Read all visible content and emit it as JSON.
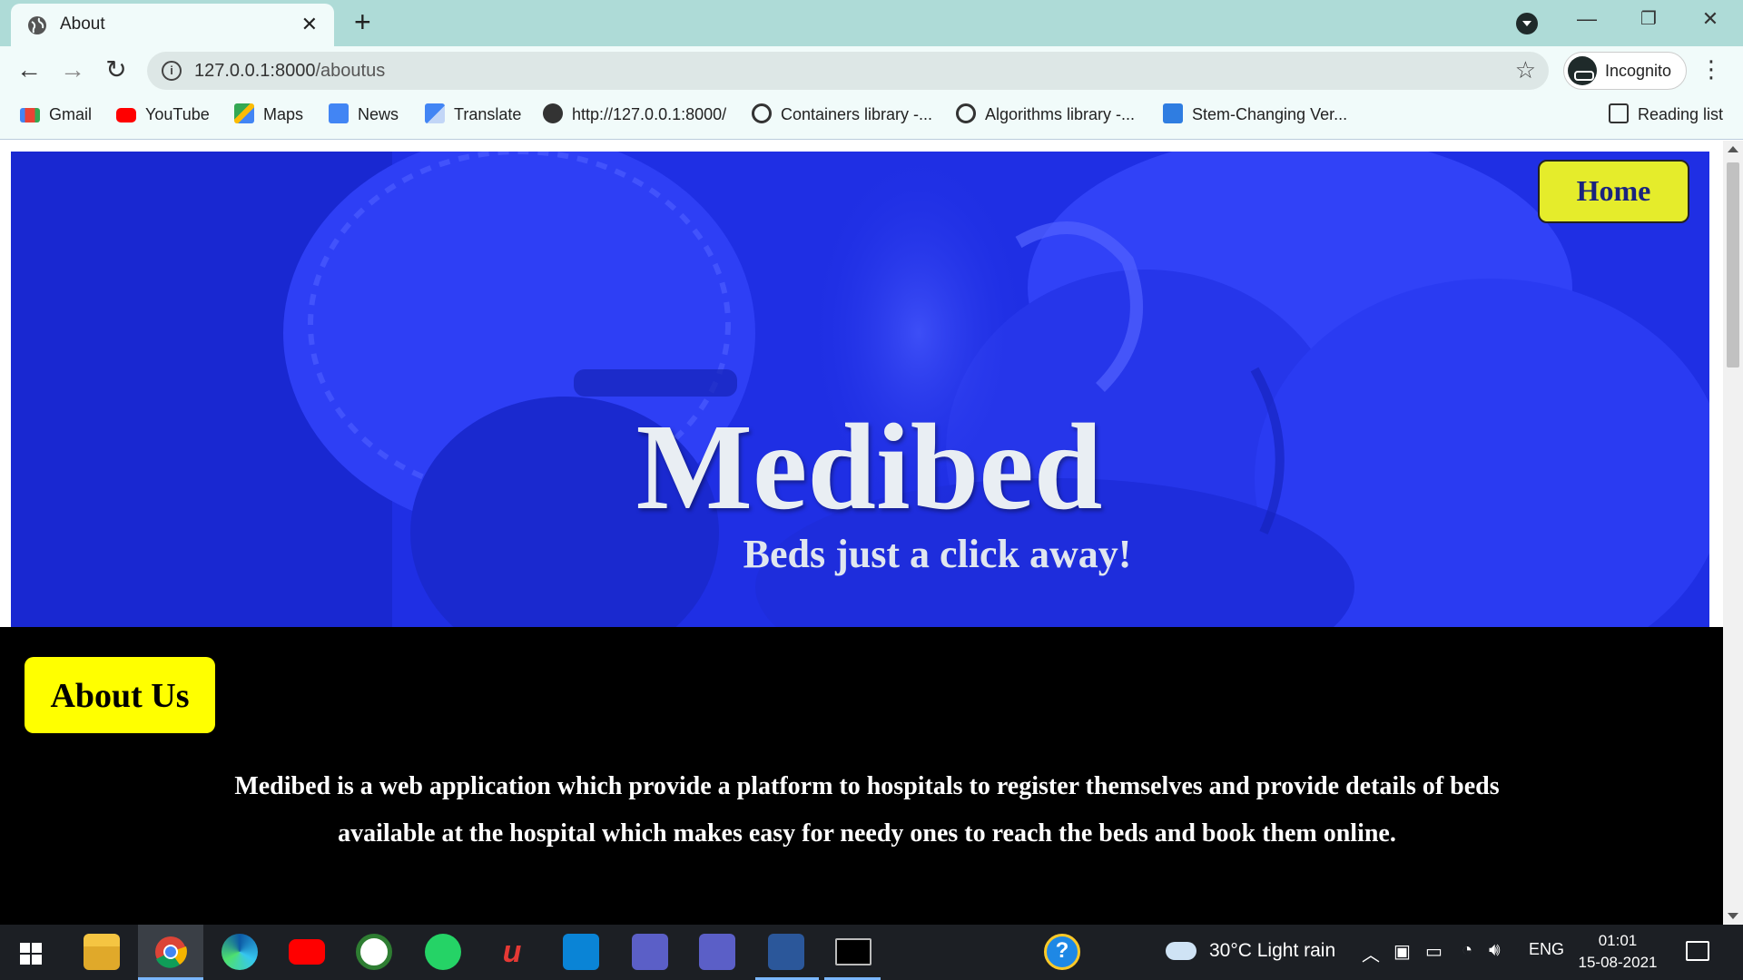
{
  "browser": {
    "tab_title": "About",
    "url_host": "127.0.0.1:8000",
    "url_path": "/aboutus",
    "incognito_label": "Incognito",
    "bookmarks": [
      {
        "label": "Gmail",
        "icon": "gmail-icon",
        "color": "#ea4335"
      },
      {
        "label": "YouTube",
        "icon": "youtube-icon",
        "color": "#ff0000"
      },
      {
        "label": "Maps",
        "icon": "maps-icon",
        "color": "#34a853"
      },
      {
        "label": "News",
        "icon": "news-icon",
        "color": "#4285f4"
      },
      {
        "label": "Translate",
        "icon": "translate-icon",
        "color": "#4285f4"
      },
      {
        "label": "http://127.0.0.1:8000/",
        "icon": "globe-icon",
        "color": "#333333"
      },
      {
        "label": "Containers library -...",
        "icon": "cpp-icon",
        "color": "#333333"
      },
      {
        "label": "Algorithms library -...",
        "icon": "cpp-icon",
        "color": "#333333"
      },
      {
        "label": "Stem-Changing Ver...",
        "icon": "bookmark-app-icon",
        "color": "#2f7de1"
      }
    ],
    "reading_list": "Reading list"
  },
  "page": {
    "nav_home": "Home",
    "brand": "Medibed",
    "tagline": "Beds just a click away!",
    "about_button": "About Us",
    "about_text": "Medibed is a web application which provide a platform to hospitals to register themselves and provide details of beds available at the hospital which makes easy for needy ones to reach the beds and book them online."
  },
  "taskbar": {
    "weather": "30°C  Light rain",
    "language": "ENG",
    "time": "01:01",
    "date": "15-08-2021"
  },
  "colors": {
    "hero_overlay": "#2233ee",
    "button_yellow": "#ffff00",
    "home_button": "#e5ec2b",
    "tab_strip": "#aedbd7"
  }
}
